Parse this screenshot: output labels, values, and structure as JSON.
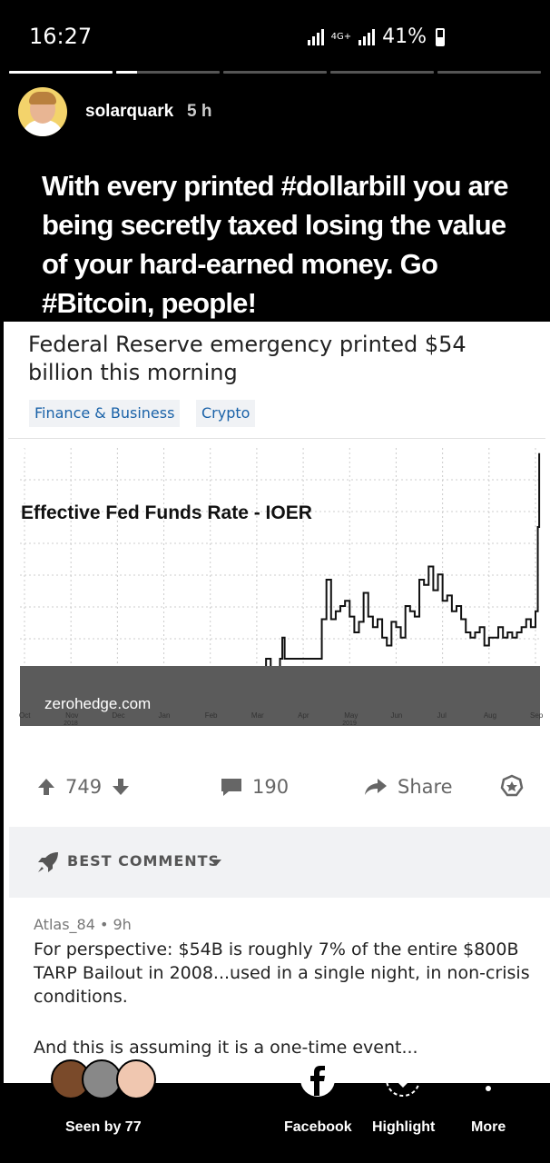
{
  "status_bar": {
    "time": "16:27",
    "network": "4G+",
    "battery": "41%"
  },
  "story": {
    "segments_total": 5,
    "segment_progress": [
      1,
      0.2,
      0,
      0,
      0
    ]
  },
  "header": {
    "username": "solarquark",
    "time_ago": "5 h"
  },
  "caption": "With every printed #dollarbill you are being secretly taxed losing the value of your hard-earned money. Go #Bitcoin, people!",
  "post": {
    "title": "Federal Reserve emergency printed $54 billion this morning",
    "flairs": [
      "Finance & Business",
      "Crypto"
    ],
    "image": {
      "label": "Effective Fed Funds Rate - IOER",
      "source": "zerohedge.com"
    },
    "actions": {
      "votes": "749",
      "comments": "190",
      "share_label": "Share"
    }
  },
  "comments_sort": "BEST COMMENTS",
  "comment": {
    "author": "Atlas_84",
    "time": "9h",
    "meta": "Atlas_84 • 9h",
    "body": "For perspective: $54B is roughly 7% of the entire $800B TARP Bailout in 2008...used in a single night, in non-crisis conditions.",
    "body2": "And this is assuming it is a one-time event..."
  },
  "bottom_bar": {
    "seen_by": "Seen by 77",
    "facebook": "Facebook",
    "highlight": "Highlight",
    "more": "More"
  },
  "chart_data": {
    "type": "line",
    "title": "Effective Fed Funds Rate - IOER",
    "xlabel": "",
    "ylabel": "",
    "categories": [
      "Oct 2018",
      "Nov",
      "Dec",
      "Jan",
      "Feb",
      "Mar",
      "Apr",
      "May 2019",
      "Jun",
      "Jul",
      "Aug",
      "Sep"
    ],
    "tick_labels": [
      "Oct",
      "Nov",
      "Dec",
      "Jan",
      "Feb",
      "Mar",
      "Apr",
      "May",
      "Jun",
      "Jul",
      "Aug",
      "Sep"
    ],
    "tick_sublabels": {
      "Nov": "2018",
      "May": "2019"
    },
    "ylim": [
      0,
      100
    ],
    "grid": true,
    "series": [
      {
        "x": [
          0,
          0.2,
          0.3,
          0.5,
          0.6,
          0.7,
          1.0,
          1.2,
          1.3,
          1.5,
          1.7,
          1.9,
          2.0,
          3.0,
          4.0,
          5.0,
          5.2,
          5.3,
          5.5,
          5.55,
          5.6,
          6.0,
          6.3,
          6.4,
          6.5,
          6.6,
          6.7,
          6.8,
          6.9,
          7.0,
          7.1,
          7.2,
          7.3,
          7.4,
          7.5,
          7.6,
          7.7,
          7.8,
          7.9,
          8.0,
          8.1,
          8.2,
          8.3,
          8.4,
          8.5,
          8.6,
          8.7,
          8.8,
          8.9,
          9.0,
          9.1,
          9.2,
          9.3,
          9.4,
          9.5,
          9.6,
          9.7,
          9.8,
          9.9,
          10.0,
          10.1,
          10.2,
          10.3,
          10.4,
          10.5,
          10.6,
          10.7,
          10.8,
          10.9,
          11.0,
          11.05,
          11.08
        ],
        "values": [
          5,
          12,
          12,
          14,
          10,
          14,
          14,
          14,
          10,
          14,
          10,
          14,
          15,
          15,
          15,
          16,
          20,
          16,
          20,
          28,
          20,
          20,
          20,
          35,
          50,
          35,
          38,
          40,
          42,
          36,
          30,
          34,
          45,
          36,
          32,
          35,
          28,
          25,
          34,
          32,
          28,
          40,
          38,
          36,
          50,
          48,
          55,
          46,
          52,
          42,
          44,
          38,
          40,
          35,
          30,
          28,
          30,
          32,
          25,
          28,
          28,
          32,
          28,
          30,
          28,
          30,
          32,
          35,
          32,
          38,
          70,
          98
        ]
      }
    ]
  }
}
